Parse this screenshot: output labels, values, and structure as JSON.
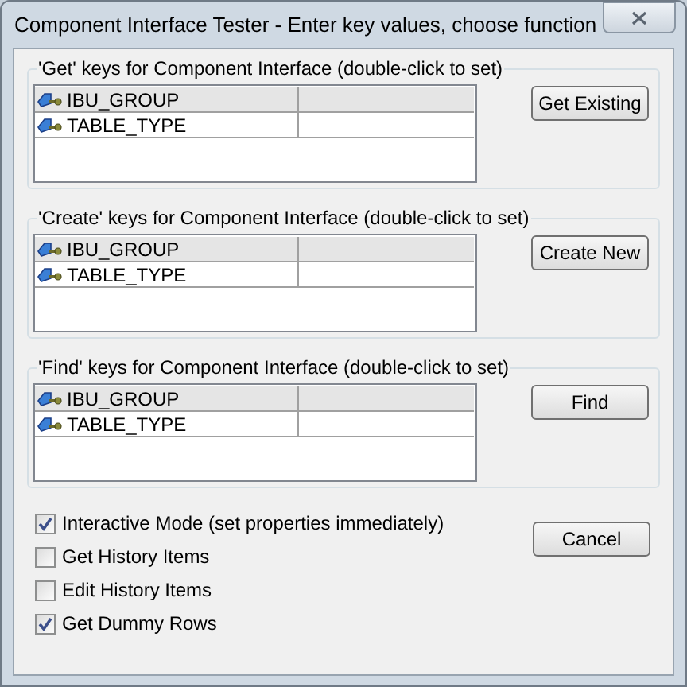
{
  "window": {
    "title": "Component Interface Tester - Enter key values, choose function"
  },
  "groups": [
    {
      "label": "'Get' keys for Component Interface (double-click to set)",
      "rows": [
        {
          "key": "IBU_GROUP",
          "selected": true
        },
        {
          "key": "TABLE_TYPE",
          "selected": false
        }
      ],
      "button": "Get Existing"
    },
    {
      "label": "'Create' keys for Component Interface (double-click to set)",
      "rows": [
        {
          "key": "IBU_GROUP",
          "selected": true
        },
        {
          "key": "TABLE_TYPE",
          "selected": false
        }
      ],
      "button": "Create New"
    },
    {
      "label": "'Find' keys for Component Interface (double-click to set)",
      "rows": [
        {
          "key": "IBU_GROUP",
          "selected": true
        },
        {
          "key": "TABLE_TYPE",
          "selected": false
        }
      ],
      "button": "Find"
    }
  ],
  "options": [
    {
      "label": "Interactive Mode (set properties immediately)",
      "checked": true
    },
    {
      "label": "Get History Items",
      "checked": false
    },
    {
      "label": "Edit History Items",
      "checked": false
    },
    {
      "label": "Get Dummy Rows",
      "checked": true
    }
  ],
  "cancel_button": "Cancel"
}
